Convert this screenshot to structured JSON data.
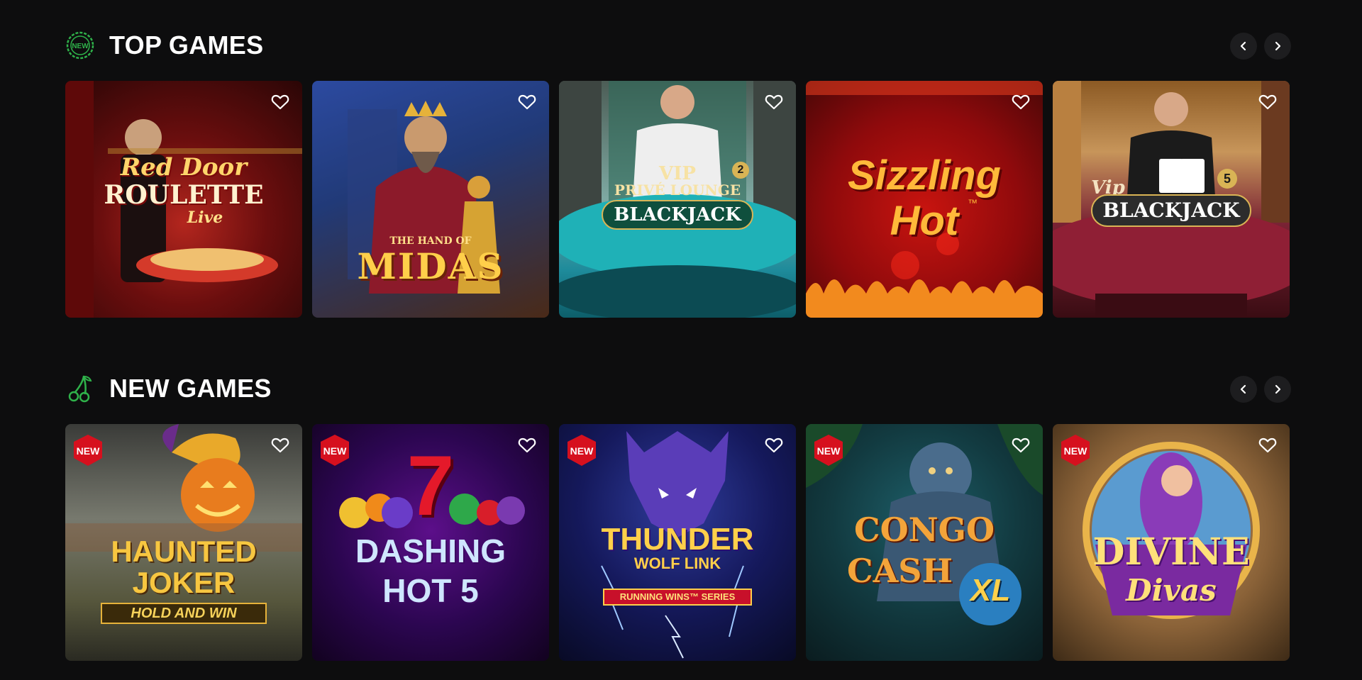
{
  "sections": [
    {
      "title": "TOP GAMES",
      "icon": "new-badge-icon",
      "games": [
        {
          "name": "Red Door Roulette Live",
          "art_line1": "Red Door",
          "art_line2": "ROULETTE",
          "art_line3": "Live",
          "new": false
        },
        {
          "name": "The Hand of Midas",
          "art_line1": "THE HAND OF",
          "art_line2": "MIDAS",
          "new": false
        },
        {
          "name": "VIP Privé Lounge Blackjack 2",
          "art_line1": "VIP",
          "art_line2": "PRIVÉ LOUNGE",
          "art_line3": "BLACKJACK",
          "art_num": "2",
          "new": false
        },
        {
          "name": "Sizzling Hot",
          "art_line1": "Sizzling",
          "art_line2": "Hot",
          "art_tm": "™",
          "new": false
        },
        {
          "name": "Vip Blackjack 5",
          "art_line1": "Vip",
          "art_line2": "BLACKJACK",
          "art_num": "5",
          "new": false
        }
      ]
    },
    {
      "title": "NEW GAMES",
      "icon": "cherry-icon",
      "games": [
        {
          "name": "Haunted Joker Hold and Win",
          "art_line1": "HAUNTED",
          "art_line2": "JOKER",
          "art_line3": "HOLD AND WIN",
          "new": true
        },
        {
          "name": "Dashing Hot 5",
          "art_line1": "7",
          "art_line2": "DASHING",
          "art_line3": "HOT 5",
          "new": true
        },
        {
          "name": "Thunder Wolf Link",
          "art_line1": "THUNDER",
          "art_line2": "WOLF LINK",
          "art_line3": "RUNNING WINS™ SERIES",
          "new": true
        },
        {
          "name": "Congo Cash XL",
          "art_line1": "CONGO",
          "art_line2": "CASH",
          "art_line3": "XL",
          "new": true
        },
        {
          "name": "Divine Divas",
          "art_line1": "DIVINE",
          "art_line2": "Divas",
          "new": true
        }
      ]
    }
  ],
  "badge_label": "NEW",
  "colors": {
    "background": "#0d0d0e",
    "accent_green": "#2fb24a",
    "badge_red": "#d6101e",
    "arrow_bg": "#1d1d1f"
  }
}
